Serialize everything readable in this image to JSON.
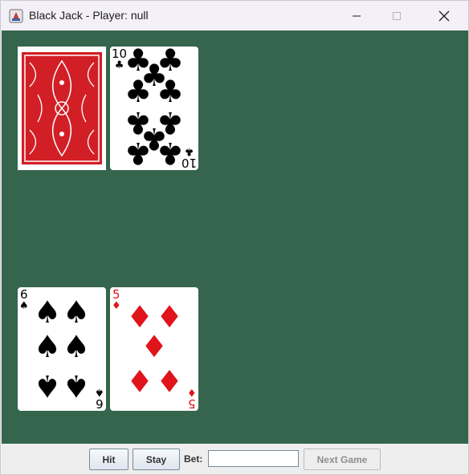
{
  "window": {
    "title": "Black Jack - Player: null",
    "controls": [
      "minimize-icon",
      "maximize-icon",
      "close-icon"
    ]
  },
  "colors": {
    "table_felt": "#35654d",
    "red_suit": "#e0141b",
    "black_suit": "#000000",
    "card_back": "#d21f26"
  },
  "dealer": {
    "cards": [
      {
        "face_down": true,
        "icon": "card-back-icon"
      },
      {
        "rank": "10",
        "suit": "♣",
        "color": "black"
      }
    ]
  },
  "player": {
    "cards": [
      {
        "rank": "6",
        "suit": "♠",
        "color": "black"
      },
      {
        "rank": "5",
        "suit": "♦",
        "color": "red"
      }
    ]
  },
  "controls": {
    "hit_label": "Hit",
    "stay_label": "Stay",
    "bet_label": "Bet:",
    "bet_value": "",
    "bet_placeholder": "",
    "next_game_label": "Next Game",
    "next_game_enabled": false
  }
}
